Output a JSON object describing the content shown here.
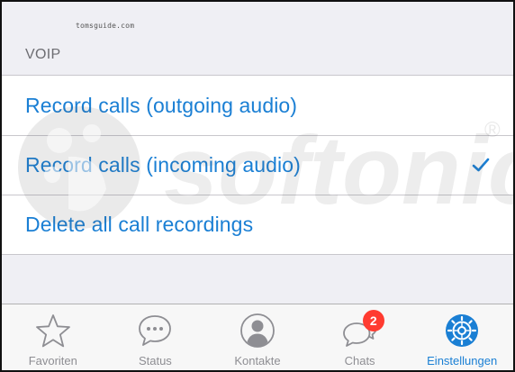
{
  "status_bar": {
    "watermark_text": "tomsguide.com"
  },
  "section": {
    "header": "VOIP"
  },
  "settings": {
    "items": [
      {
        "label": "Record calls (outgoing audio)",
        "checked": false
      },
      {
        "label": "Record calls (incoming audio)",
        "checked": true
      },
      {
        "label": "Delete all call recordings",
        "checked": false
      }
    ]
  },
  "watermark": {
    "brand": "softonic",
    "registered_mark": "®"
  },
  "tab_bar": {
    "tabs": [
      {
        "label": "Favoriten",
        "icon": "star-icon",
        "active": false
      },
      {
        "label": "Status",
        "icon": "speech-bubble-dots-icon",
        "active": false
      },
      {
        "label": "Kontakte",
        "icon": "contact-icon",
        "active": false
      },
      {
        "label": "Chats",
        "icon": "chats-icon",
        "active": false,
        "badge": "2"
      },
      {
        "label": "Einstellungen",
        "icon": "gear-icon",
        "active": true
      }
    ]
  },
  "colors": {
    "accent": "#1a7fd4",
    "badge": "#ff3b30",
    "inactive_tab": "#8e8e93",
    "background": "#efeff4"
  }
}
